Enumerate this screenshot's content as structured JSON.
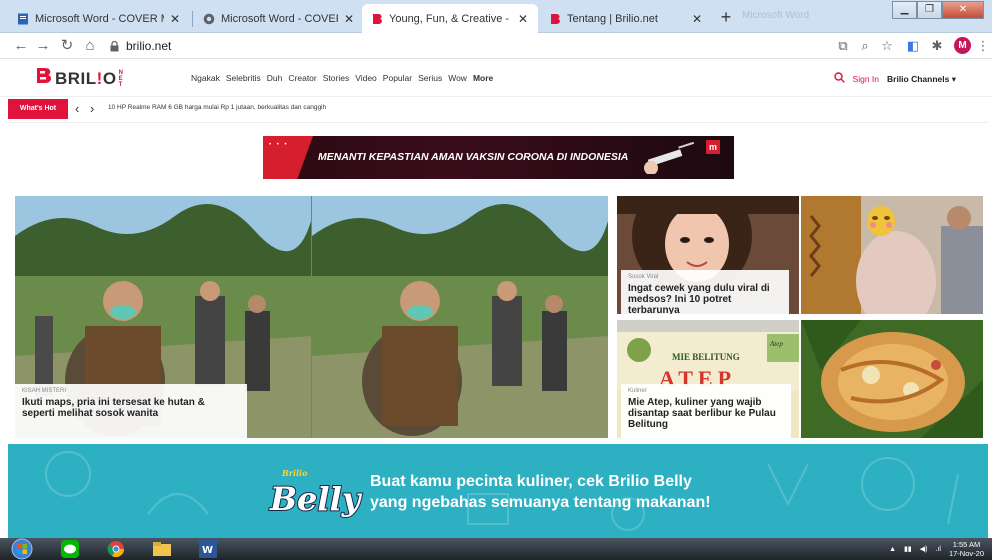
{
  "browser": {
    "tabs": [
      {
        "title": "Microsoft Word - COVER MAGAZ",
        "icon": "page-icon",
        "active": false
      },
      {
        "title": "Microsoft Word - COVER MAGAZ",
        "icon": "globe-icon",
        "active": false
      },
      {
        "title": "Young, Fun, & Creative - Brilio.ne",
        "icon": "brilio-icon",
        "active": true
      },
      {
        "title": "Tentang | Brilio.net",
        "icon": "brilio-icon",
        "active": false
      }
    ],
    "new_tab": "+",
    "ghost_tab": "Microsoft Word",
    "address": "brilio.net",
    "profile_initial": "M"
  },
  "site": {
    "logo": {
      "prefix": "BRIL",
      "bang": "!",
      "suffix": "O",
      "super": "NET"
    },
    "nav": [
      "Ngakak",
      "Selebritis",
      "Duh",
      "Creator",
      "Stories",
      "Video",
      "Popular",
      "Serius",
      "Wow",
      "More"
    ],
    "sign_in": "Sign In",
    "channels": "Brilio Channels ▾",
    "whats_hot_label": "What's Hot",
    "whats_hot_text": "10 HP Realme RAM 6 GB harga mulai Rp 1 jutaan, berkualitas dan canggih",
    "banner_text": "MENANTI KEPASTIAN AMAN VAKSIN CORONA DI INDONESIA",
    "banner_badge": "m"
  },
  "articles": [
    {
      "kicker": "KISAH MISTERI",
      "headline": "Ikuti maps, pria ini tersesat ke hutan & seperti melihat sosok wanita"
    },
    {
      "kicker": "Sosok Viral",
      "headline": "Ingat cewek yang dulu viral di medsos? Ini 10 potret terbarunya"
    },
    {
      "kicker": "Kuliner",
      "headline": "Mie Atep, kuliner yang wajib disantap saat berlibur ke Pulau Belitung"
    }
  ],
  "kuliner_sign": {
    "top": "MIE BELITUNG",
    "bottom": "ATEP",
    "tag": "Atep"
  },
  "promo": {
    "logo_small": "Brilio",
    "logo_big": "Belly",
    "line1": "Buat kamu pecinta kuliner, cek Brilio Belly",
    "line2": "yang ngebahas semuanya tentang makanan!"
  },
  "taskbar": {
    "time": "1:55 AM",
    "date": "17-Nov-20"
  },
  "colors": {
    "brand_red": "#e0133c",
    "promo_teal": "#2db1c2",
    "tabstrip": "#cfe0f3"
  }
}
